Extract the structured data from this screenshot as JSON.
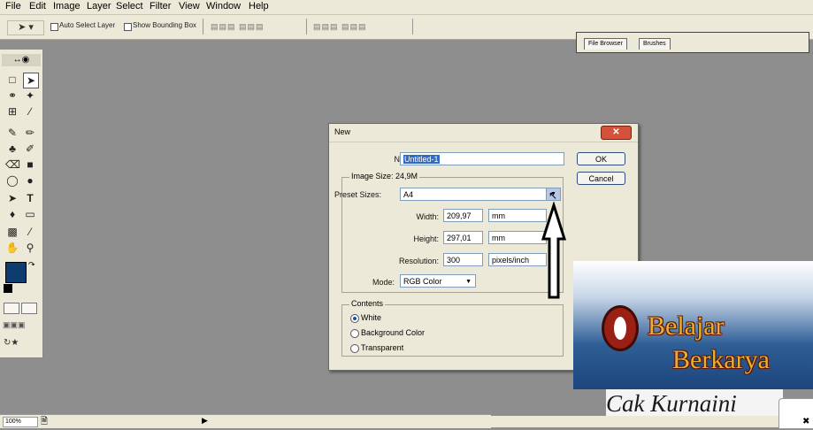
{
  "menu": [
    "File",
    "Edit",
    "Image",
    "Layer",
    "Select",
    "Filter",
    "View",
    "Window",
    "Help"
  ],
  "options_bar": {
    "auto_select_layer": "Auto Select Layer",
    "show_bounding_box": "Show Bounding Box"
  },
  "palette_well": {
    "tabs": [
      "File Browser",
      "Brushes"
    ]
  },
  "status": {
    "zoom": "100%"
  },
  "dialog": {
    "title": "New",
    "name_label": "Name:",
    "name_value": "Untitled-1",
    "image_size_label": "Image Size: 24,9M",
    "preset_label": "Preset Sizes:",
    "preset_value": "A4",
    "width_label": "Width:",
    "width_value": "209,97",
    "width_unit": "mm",
    "height_label": "Height:",
    "height_value": "297,01",
    "height_unit": "mm",
    "resolution_label": "Resolution:",
    "resolution_value": "300",
    "resolution_unit": "pixels/inch",
    "mode_label": "Mode:",
    "mode_value": "RGB Color",
    "contents_label": "Contents",
    "contents_options": [
      "White",
      "Background Color",
      "Transparent"
    ],
    "contents_selected": "White",
    "ok_label": "OK",
    "cancel_label": "Cancel"
  },
  "watermark": {
    "line1": "Belajar",
    "line2": "Berkarya",
    "signature": "Cak Kurnaini"
  },
  "colors": {
    "foreground": "#0d3d6e",
    "background": "#ffffff",
    "workspace": "#8e8e8e"
  }
}
